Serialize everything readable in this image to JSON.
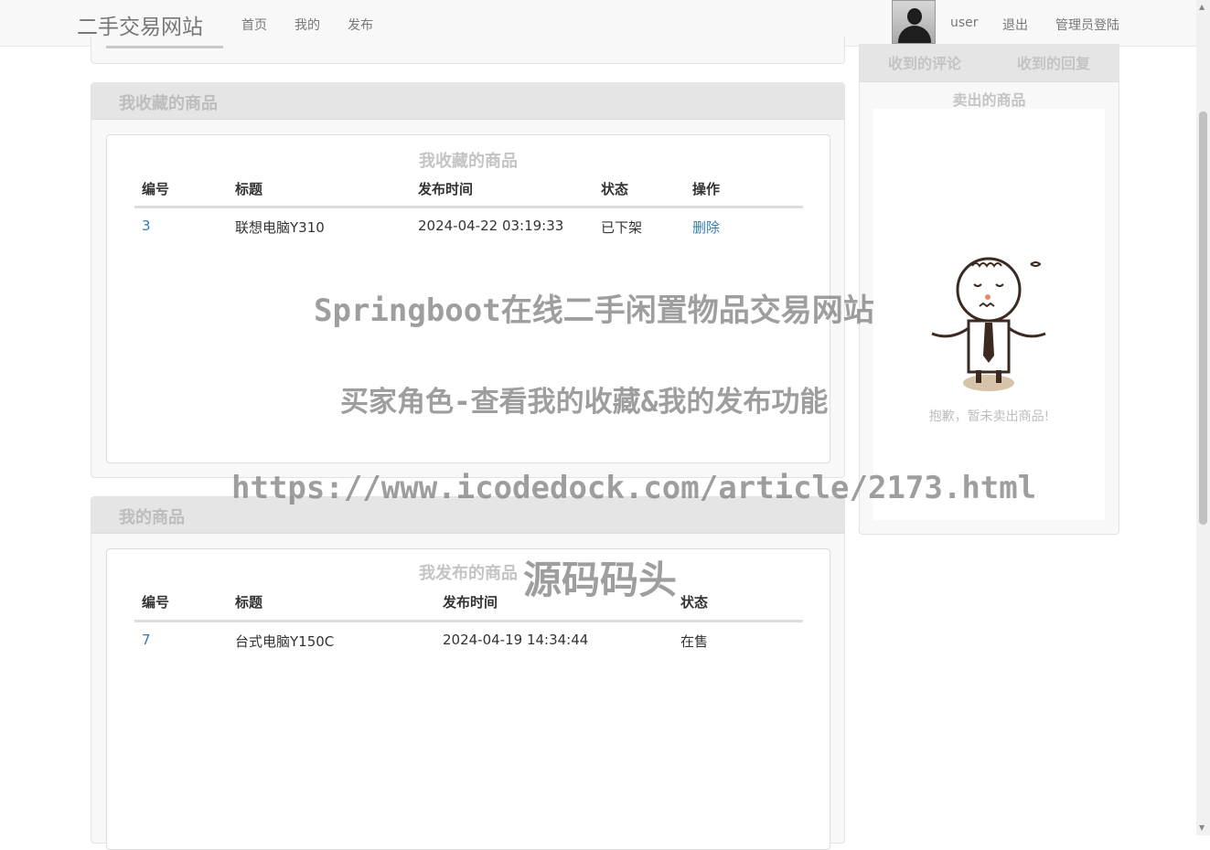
{
  "navbar": {
    "brand": "二手交易网站",
    "links": [
      "首页",
      "我的",
      "发布"
    ],
    "username": "user",
    "logout": "退出",
    "admin_login": "管理员登陆"
  },
  "favorites": {
    "panel_title": "我收藏的商品",
    "table_caption": "我收藏的商品",
    "columns": [
      "编号",
      "标题",
      "发布时间",
      "状态",
      "操作"
    ],
    "rows": [
      {
        "id": "3",
        "title": "联想电脑Y310",
        "time": "2024-04-22 03:19:33",
        "status": "已下架",
        "action": "删除"
      }
    ]
  },
  "my_goods": {
    "panel_title": "我的商品",
    "table_caption": "我发布的商品",
    "columns": [
      "编号",
      "标题",
      "发布时间",
      "状态"
    ],
    "rows": [
      {
        "id": "7",
        "title": "台式电脑Y150C",
        "time": "2024-04-19 14:34:44",
        "status": "在售"
      }
    ]
  },
  "sidebar": {
    "tabs": [
      "收到的评论",
      "收到的回复"
    ],
    "section_title": "卖出的商品",
    "empty_message": "抱歉，暂未卖出商品!"
  },
  "watermark": {
    "line1": "Springboot在线二手闲置物品交易网站",
    "line2": "买家角色-查看我的收藏&我的发布功能",
    "line3": "https://www.icodedock.com/article/2173.html",
    "line4": "源码码头"
  },
  "colors": {
    "link": "#337ab7",
    "panel_head": "#e5e5e5",
    "navbar_bg": "#f8f8f8"
  }
}
